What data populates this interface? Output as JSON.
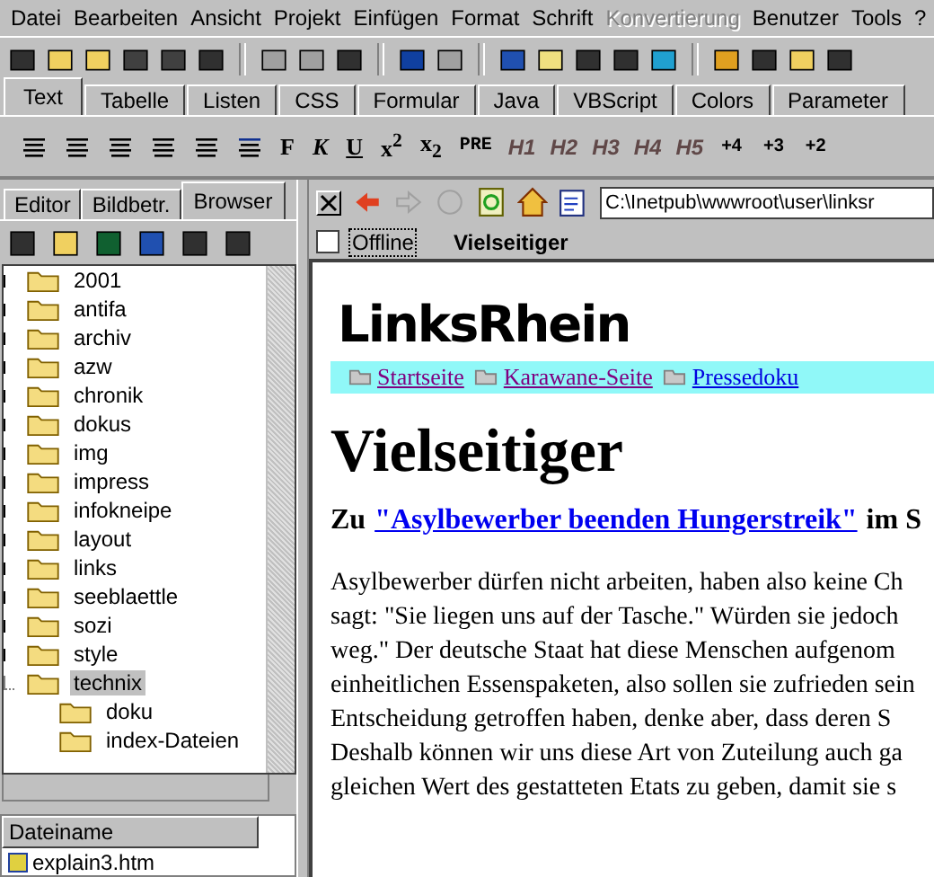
{
  "menu": [
    {
      "label": "Datei",
      "disabled": false
    },
    {
      "label": "Bearbeiten",
      "disabled": false
    },
    {
      "label": "Ansicht",
      "disabled": false
    },
    {
      "label": "Projekt",
      "disabled": false
    },
    {
      "label": "Einfügen",
      "disabled": false
    },
    {
      "label": "Format",
      "disabled": false
    },
    {
      "label": "Schrift",
      "disabled": false
    },
    {
      "label": "Konvertierung",
      "disabled": true
    },
    {
      "label": "Benutzer",
      "disabled": false
    },
    {
      "label": "Tools",
      "disabled": false
    },
    {
      "label": "?",
      "disabled": false
    }
  ],
  "tabs": [
    {
      "label": "Text",
      "selected": true
    },
    {
      "label": "Tabelle",
      "selected": false
    },
    {
      "label": "Listen",
      "selected": false
    },
    {
      "label": "CSS",
      "selected": false
    },
    {
      "label": "Formular",
      "selected": false
    },
    {
      "label": "Java",
      "selected": false
    },
    {
      "label": "VBScript",
      "selected": false
    },
    {
      "label": "Colors",
      "selected": false
    },
    {
      "label": "Parameter",
      "selected": false
    }
  ],
  "format_buttons": [
    {
      "label": "F",
      "kind": "bold"
    },
    {
      "label": "K",
      "kind": "italic"
    },
    {
      "label": "U",
      "kind": "underline"
    },
    {
      "label": "x$^{2}$",
      "kind": "script"
    },
    {
      "label": "x$_{2}$",
      "kind": "script"
    },
    {
      "label": "PRE",
      "kind": "pre"
    },
    {
      "label": "H1",
      "kind": "heading"
    },
    {
      "label": "H2",
      "kind": "heading"
    },
    {
      "label": "H3",
      "kind": "heading"
    },
    {
      "label": "H4",
      "kind": "heading"
    },
    {
      "label": "H5",
      "kind": "heading"
    },
    {
      "label": "+4",
      "kind": "size"
    },
    {
      "label": "+3",
      "kind": "size"
    },
    {
      "label": "+2",
      "kind": "size"
    }
  ],
  "side_tabs": [
    {
      "label": "Editor",
      "selected": false
    },
    {
      "label": "Bildbetr.",
      "selected": false
    },
    {
      "label": "Browser",
      "selected": true
    }
  ],
  "tree": [
    {
      "label": "2001",
      "expanded": false,
      "selected": false
    },
    {
      "label": "antifa",
      "expanded": false,
      "selected": false
    },
    {
      "label": "archiv",
      "expanded": false,
      "selected": false
    },
    {
      "label": "azw",
      "expanded": false,
      "selected": false
    },
    {
      "label": "chronik",
      "expanded": false,
      "selected": false
    },
    {
      "label": "dokus",
      "expanded": false,
      "selected": false
    },
    {
      "label": "img",
      "expanded": false,
      "selected": false
    },
    {
      "label": "impress",
      "expanded": false,
      "selected": false
    },
    {
      "label": "infokneipe",
      "expanded": false,
      "selected": false
    },
    {
      "label": "layout",
      "expanded": false,
      "selected": false
    },
    {
      "label": "links",
      "expanded": false,
      "selected": false
    },
    {
      "label": "seeblaettle",
      "expanded": false,
      "selected": false
    },
    {
      "label": "sozi",
      "expanded": false,
      "selected": false
    },
    {
      "label": "style",
      "expanded": false,
      "selected": false
    },
    {
      "label": "technix",
      "expanded": true,
      "selected": true,
      "children": [
        {
          "label": "doku",
          "selected": false
        },
        {
          "label": "index-Dateien",
          "selected": false
        }
      ]
    }
  ],
  "file_list": {
    "column": "Dateiname",
    "rows": [
      "explain3.htm"
    ]
  },
  "browser": {
    "address": "C:\\Inetpub\\wwwroot\\user\\linksr",
    "offline": {
      "label": "Offline",
      "checked": false
    },
    "page_title": "Vielseitiger"
  },
  "page": {
    "logo": "LinksRhein",
    "nav_links": [
      "Startseite",
      "Karawane-Seite",
      "Pressedoku"
    ],
    "heading": "Vielseitiger",
    "subheading_prefix": "Zu",
    "subheading_link": "\"Asylbewerber beenden Hungerstreik\"",
    "subheading_suffix": "im S",
    "body_lines": [
      "Asylbewerber dürfen nicht arbeiten, haben also keine Ch",
      "sagt: \"Sie liegen uns auf der Tasche.\" Würden sie jedoch",
      "weg.\" Der deutsche Staat hat diese Menschen aufgenom",
      "einheitlichen Essenspaketen, also sollen sie zufrieden sein",
      "Entscheidung getroffen haben, denke aber, dass deren S",
      "Deshalb können wir uns diese Art von Zuteilung auch ga",
      "gleichen Wert des gestatteten Etats zu geben, damit sie s"
    ]
  }
}
